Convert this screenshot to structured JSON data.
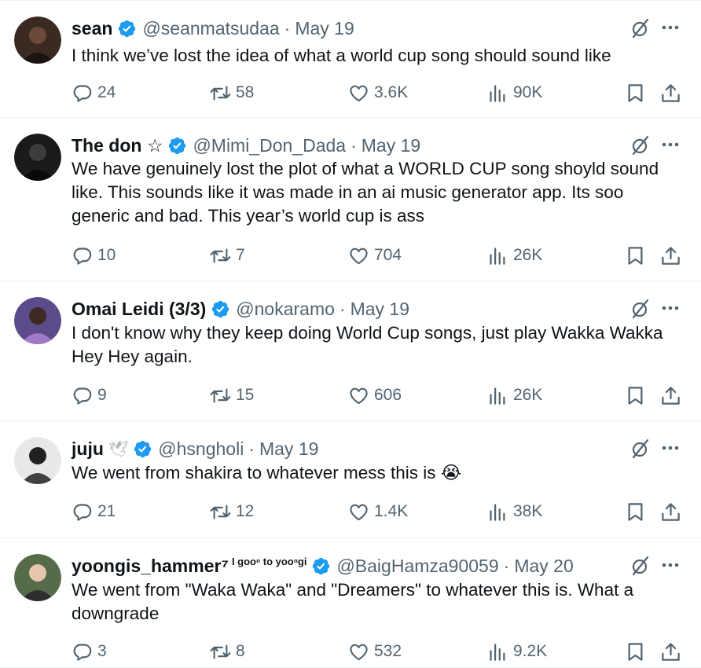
{
  "tweets": [
    {
      "name": "sean",
      "name_extra": "",
      "badge_emoji": "",
      "handle": "@seanmatsudaa",
      "date": "May 19",
      "text": "I think we’ve lost the idea of what a world cup song should sound like",
      "replies": "24",
      "retweets": "58",
      "likes": "3.6K",
      "views": "90K"
    },
    {
      "name": "The don ☆",
      "name_extra": "",
      "badge_emoji": "",
      "handle": "@Mimi_Don_Dada",
      "date": "May 19",
      "text": "We have genuinely lost the plot of what a WORLD CUP song shoyld sound like. This sounds like it was made in an ai music generator app. Its soo generic and bad. This year’s world cup is ass",
      "replies": "10",
      "retweets": "7",
      "likes": "704",
      "views": "26K"
    },
    {
      "name": "Omai Leidi (3/3)",
      "name_extra": "",
      "badge_emoji": "",
      "handle": "@nokaramo",
      "date": "May 19",
      "text": "I don't know why they keep doing World Cup songs, just play Wakka Wakka Hey Hey again.",
      "replies": "9",
      "retweets": "15",
      "likes": "606",
      "views": "26K"
    },
    {
      "name": "juju",
      "name_extra": "",
      "badge_emoji": "🕊",
      "handle": "@hsngholi",
      "date": "May 19",
      "text": "We went from shakira to whatever mess this is 😭",
      "replies": "21",
      "retweets": "12",
      "likes": "1.4K",
      "views": "38K"
    },
    {
      "name": "yoongis_hammer⁷",
      "name_extra": "I gooⁿ to yooⁿgi",
      "badge_emoji": "",
      "handle": "@BaigHamza90059",
      "date": "May 20",
      "text": "We went from \"Waka Waka\" and \"Dreamers\" to whatever this is. What a downgrade",
      "replies": "3",
      "retweets": "8",
      "likes": "532",
      "views": "9.2K"
    }
  ],
  "icons": {
    "reply": "reply-icon",
    "retweet": "retweet-icon",
    "like": "heart-icon",
    "views": "views-bar-chart-icon",
    "bookmark": "bookmark-icon",
    "share": "share-icon",
    "grok": "grok-icon",
    "more": "more-dots-icon",
    "verified": "verified-badge-icon"
  },
  "colors": {
    "verified": "#1d9bf0",
    "secondary_text": "#536471",
    "primary_text": "#0f1419"
  }
}
